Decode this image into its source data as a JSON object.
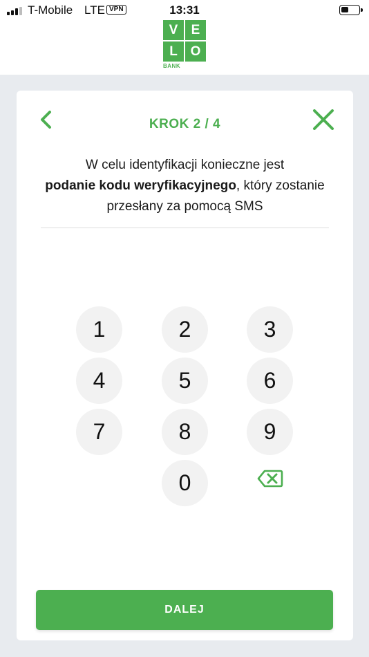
{
  "status_bar": {
    "carrier": "T-Mobile",
    "network": "LTE",
    "vpn": "VPN",
    "time": "13:31",
    "battery_level": 0.45
  },
  "logo": {
    "letters": [
      "V",
      "E",
      "L",
      "O"
    ],
    "subtitle": "BANK",
    "color": "#4caf50"
  },
  "header": {
    "step": "KROK 2 / 4",
    "back_icon": "chevron-left-icon",
    "close_icon": "close-icon"
  },
  "message": {
    "part1": "W celu identyfikacji konieczne jest",
    "bold": "podanie kodu weryfikacyjnego",
    "part2": ", który zostanie przesłany za pomocą SMS"
  },
  "code_input": {
    "value": ""
  },
  "keypad": {
    "keys": [
      "1",
      "2",
      "3",
      "4",
      "5",
      "6",
      "7",
      "8",
      "9",
      "0"
    ],
    "delete_icon": "backspace-icon"
  },
  "next_button": {
    "label": "DALEJ"
  },
  "colors": {
    "accent": "#4caf50",
    "background": "#e8ebef",
    "key_bg": "#f2f2f2"
  }
}
